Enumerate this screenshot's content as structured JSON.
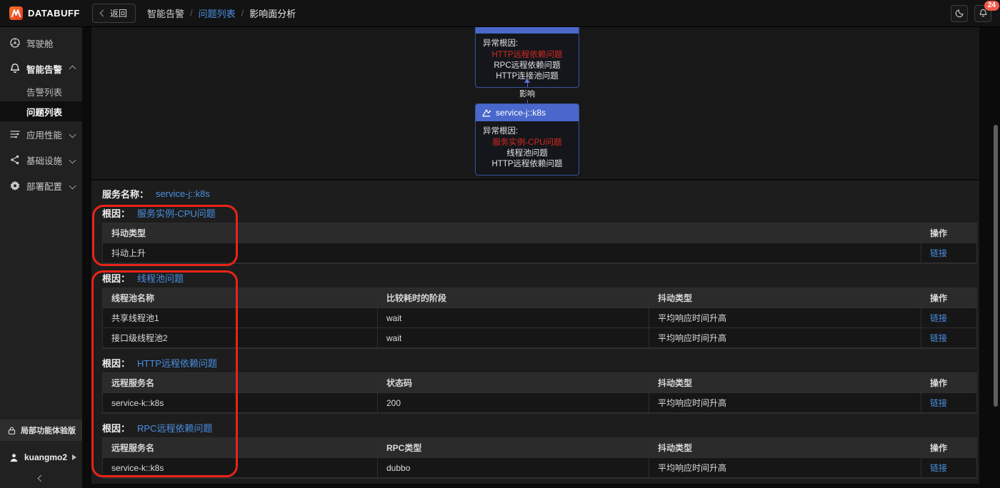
{
  "topbar": {
    "logo_text": "DATABUFF",
    "back_label": "返回",
    "breadcrumb_separator": "/",
    "breadcrumb": [
      {
        "label": "智能告警"
      },
      {
        "label": "问题列表"
      },
      {
        "label": "影响面分析"
      }
    ],
    "notification_count": "24"
  },
  "sidebar": {
    "items": [
      {
        "label": "驾驶舱"
      },
      {
        "label": "智能告警"
      },
      {
        "label": "告警列表"
      },
      {
        "label": "问题列表"
      },
      {
        "label": "应用性能"
      },
      {
        "label": "基础设施"
      },
      {
        "label": "部署配置"
      }
    ],
    "trial_label": "局部功能体验版",
    "username": "kuangmo2"
  },
  "graph": {
    "impact_label": "影响",
    "node_top": {
      "root_cause_label": "异常根因:",
      "causes": [
        "HTTP远程依赖问题",
        "RPC远程依赖问题",
        "HTTP连接池问题"
      ]
    },
    "node_service": {
      "title": "service-j::k8s",
      "root_cause_label": "异常根因:",
      "causes": [
        "服务实例-CPU问题",
        "线程池问题",
        "HTTP远程依赖问题"
      ]
    }
  },
  "detail": {
    "service_label": "服务名称：",
    "service_name": "service-j::k8s",
    "root_cause_label": "根因：",
    "sections": [
      {
        "cause": "服务实例-CPU问题",
        "columns": [
          "抖动类型",
          "操作"
        ],
        "rows": [
          [
            "抖动上升",
            "链接"
          ]
        ]
      },
      {
        "cause": "线程池问题",
        "columns": [
          "线程池名称",
          "比较耗时的阶段",
          "抖动类型",
          "操作"
        ],
        "rows": [
          [
            "共享线程池1",
            "wait",
            "平均响应时间升高",
            "链接"
          ],
          [
            "接口级线程池2",
            "wait",
            "平均响应时间升高",
            "链接"
          ]
        ]
      },
      {
        "cause": "HTTP远程依赖问题",
        "columns": [
          "远程服务名",
          "状态码",
          "抖动类型",
          "操作"
        ],
        "rows": [
          [
            "service-k::k8s",
            "200",
            "平均响应时间升高",
            "链接"
          ]
        ]
      },
      {
        "cause": "RPC远程依赖问题",
        "columns": [
          "远程服务名",
          "RPC类型",
          "抖动类型",
          "操作"
        ],
        "rows": [
          [
            "service-k::k8s",
            "dubbo",
            "平均响应时间升高",
            "链接"
          ]
        ]
      }
    ]
  },
  "colors": {
    "accent_blue": "#4a90e2",
    "node_header_blue": "#4a68cb",
    "alert_red": "#d62a1e",
    "annotation_red": "#ea2318",
    "badge_red": "#f25a50",
    "logo_orange": "#f4742c"
  }
}
